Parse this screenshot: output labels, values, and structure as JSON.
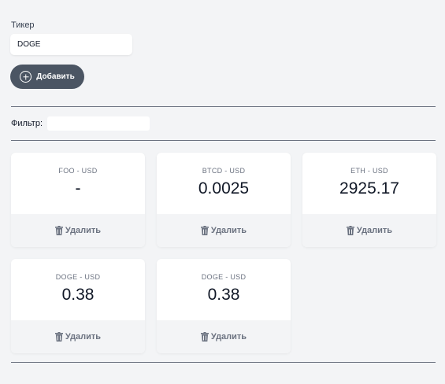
{
  "form": {
    "ticker_label": "Тикер",
    "ticker_value": "DOGE",
    "add_label": "Добавить"
  },
  "filter": {
    "label": "Фильтр:",
    "value": ""
  },
  "delete_label": "Удалить",
  "tickers": [
    {
      "pair": "FOO - USD",
      "price": "-"
    },
    {
      "pair": "BTCD - USD",
      "price": "0.0025"
    },
    {
      "pair": "ETH - USD",
      "price": "2925.17"
    },
    {
      "pair": "DOGE - USD",
      "price": "0.38"
    },
    {
      "pair": "DOGE - USD",
      "price": "0.38"
    }
  ]
}
